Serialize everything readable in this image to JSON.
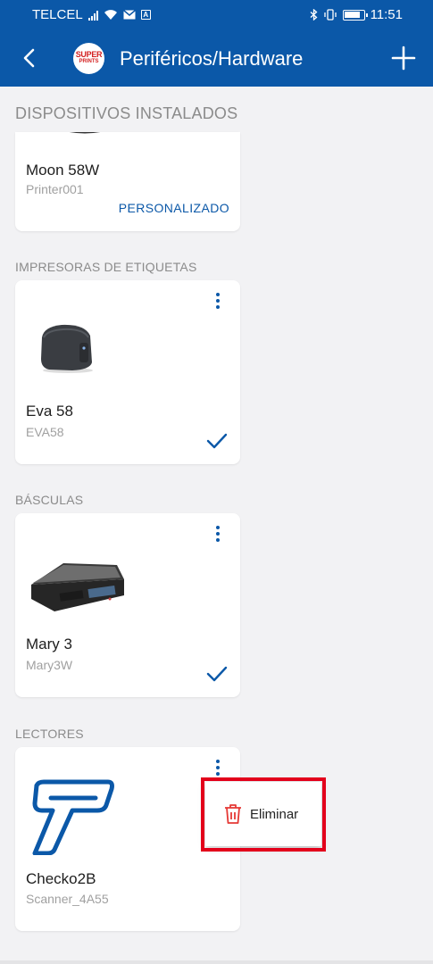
{
  "status_bar": {
    "carrier": "TELCEL",
    "time": "11:51"
  },
  "app_bar": {
    "title": "Periféricos/Hardware",
    "logo_text_top": "SUPER",
    "logo_text_bottom": "PRINTS"
  },
  "sections": {
    "installed": "DISPOSITIVOS INSTALADOS",
    "label_printers": "IMPRESORAS DE ETIQUETAS",
    "scales": "BÁSCULAS",
    "readers": "LECTORES"
  },
  "devices": {
    "printer": {
      "name": "Moon 58W",
      "id": "Printer001",
      "action": "PERSONALIZADO"
    },
    "label_printer": {
      "name": "Eva 58",
      "id": "EVA58"
    },
    "scale": {
      "name": "Mary 3",
      "id": "Mary3W"
    },
    "reader": {
      "name": "Checko2B",
      "id": "Scanner_4A55"
    }
  },
  "popup_menu": {
    "delete_label": "Eliminar"
  },
  "colors": {
    "primary": "#0b58a8",
    "highlight": "#e3001b",
    "delete_icon": "#e53935",
    "background": "#f2f2f4"
  }
}
